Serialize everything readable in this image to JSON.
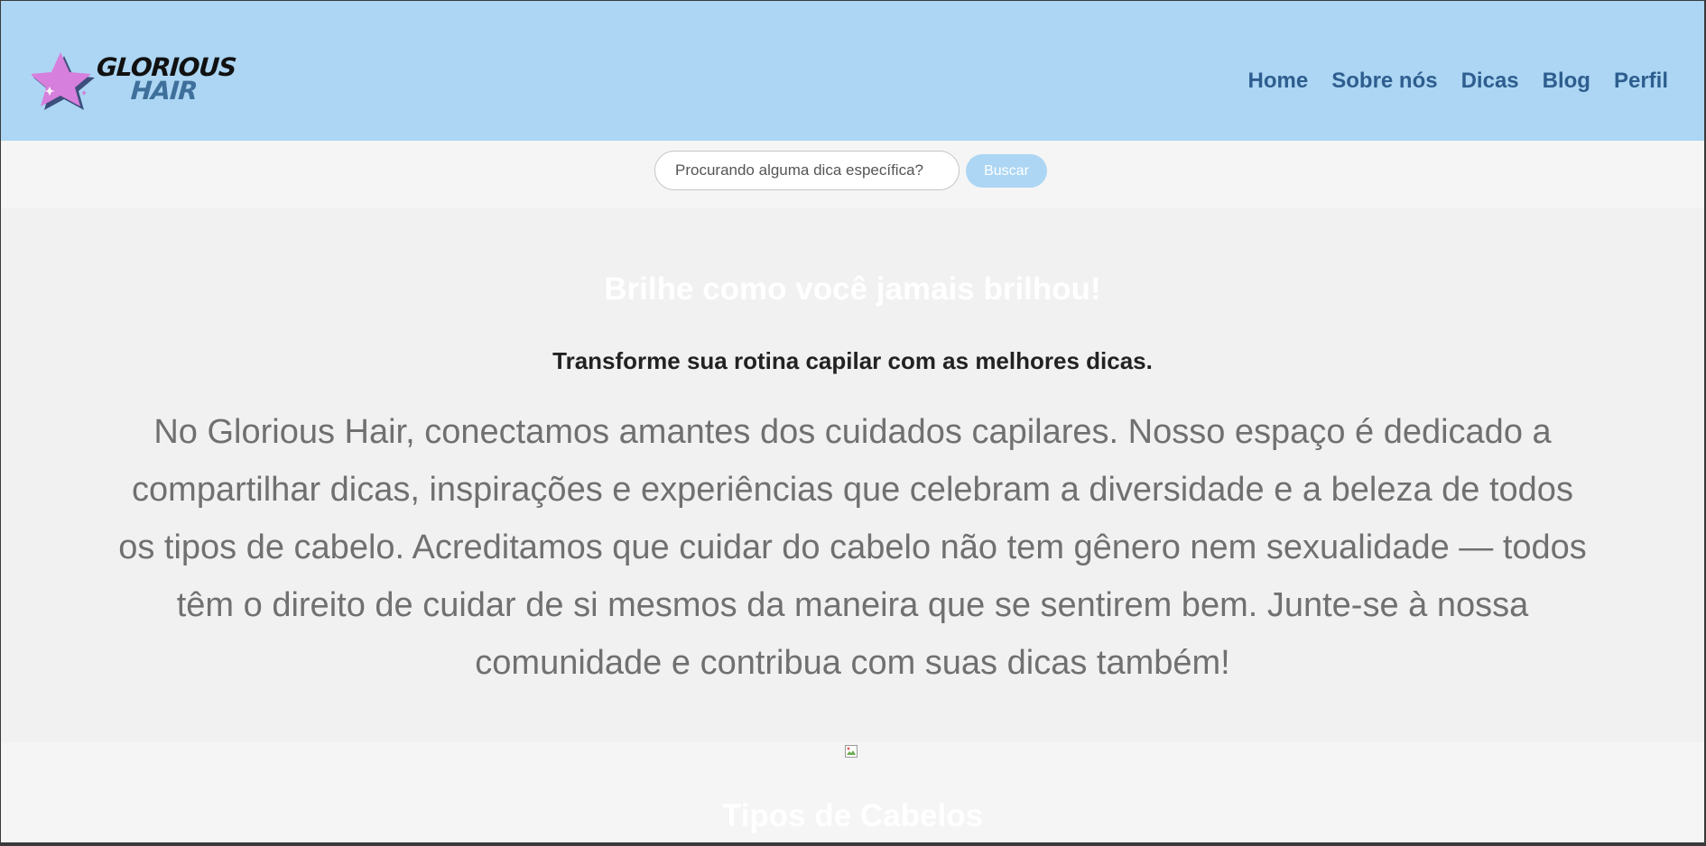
{
  "brand": {
    "line1": "GLORIOUS",
    "line2": "HAIR"
  },
  "nav": {
    "items": [
      "Home",
      "Sobre nós",
      "Dicas",
      "Blog",
      "Perfil"
    ]
  },
  "search": {
    "placeholder": "Procurando alguma dica específica?",
    "button_label": "Buscar"
  },
  "hero": {
    "title": "Brilhe como você jamais brilhou!",
    "subtitle": "Transforme sua rotina capilar com as melhores dicas.",
    "text": "No Glorious Hair, conectamos amantes dos cuidados capilares. Nosso espaço é dedicado a compartilhar dicas, inspirações e experiências que celebram a diversidade e a beleza de todos os tipos de cabelo. Acreditamos que cuidar do cabelo não tem gênero nem sexualidade — todos têm o direito de cuidar de si mesmos da maneira que se sentirem bem. Junte-se à nossa comunidade e contribua com suas dicas também!"
  },
  "section": {
    "title": "Tipos de Cabelos"
  },
  "colors": {
    "header_bg": "#acd6f3",
    "nav_link": "#2e5e8f",
    "hero_bg": "#f1f1f1",
    "page_bg": "#f5f5f5",
    "star_pink": "#d77fdd",
    "star_shadow": "#3d4f7d"
  },
  "icons": {
    "logo": "star-icon",
    "broken_image": "broken-image-icon"
  }
}
